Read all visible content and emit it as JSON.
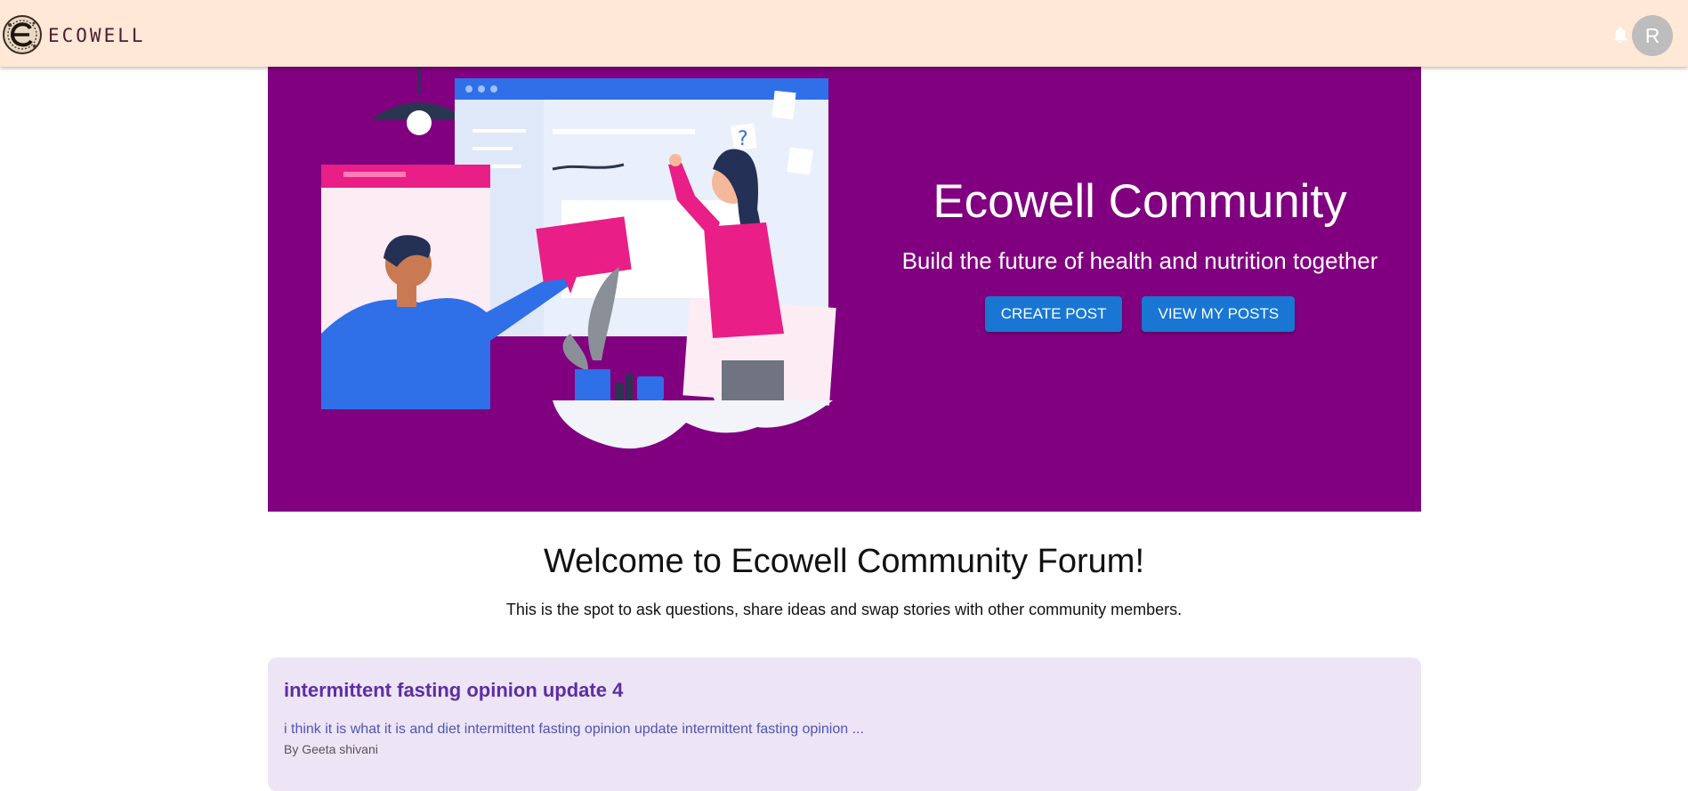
{
  "header": {
    "brand": "ECOWELL",
    "avatar_initial": "R",
    "icons": [
      "ecowell-logo-icon",
      "bell-icon"
    ]
  },
  "hero": {
    "title": "Ecowell Community",
    "subtitle": "Build the future of health and nutrition together",
    "create_post_label": "CREATE POST",
    "view_posts_label": "VIEW MY POSTS",
    "background_color": "#800080"
  },
  "welcome": {
    "title": "Welcome to Ecowell Community Forum!",
    "subtitle": "This is the spot to ask questions, share ideas and swap stories with other community members."
  },
  "posts": [
    {
      "title": "intermittent fasting opinion update 4",
      "excerpt": "i think it is what it is and diet intermittent fasting opinion update intermittent fasting opinion ...",
      "author": "By Geeta shivani"
    }
  ],
  "colors": {
    "header_bg": "#ffe8d6",
    "button_blue": "#1976d2",
    "card_bg": "#ede4f5",
    "post_title": "#5b2fa3"
  }
}
